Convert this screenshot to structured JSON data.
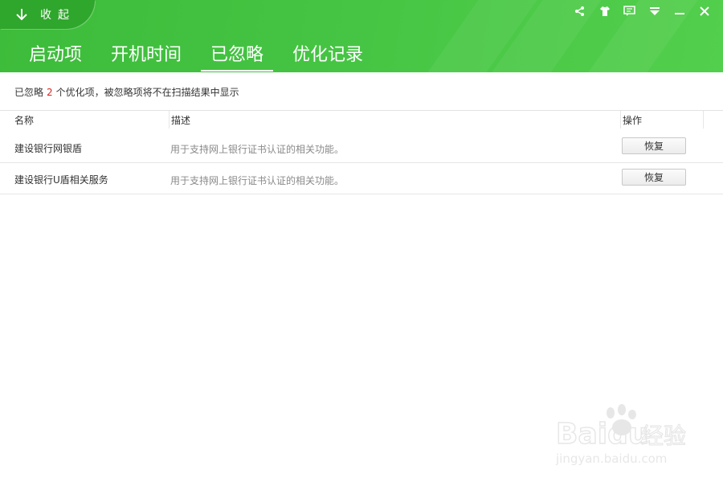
{
  "header": {
    "collapse_label": "收起",
    "window_controls": [
      "share-icon",
      "skin-icon",
      "feedback-icon",
      "menu-icon",
      "minimize-icon",
      "close-icon"
    ],
    "tabs": [
      {
        "label": "启动项",
        "active": false
      },
      {
        "label": "开机时间",
        "active": false
      },
      {
        "label": "已忽略",
        "active": true
      },
      {
        "label": "优化记录",
        "active": false
      }
    ],
    "accent": "#45c443"
  },
  "summary": {
    "prefix": "已忽略",
    "count": "2",
    "suffix": "个优化项，被忽略项将不在扫描结果中显示",
    "count_color": "#e02222"
  },
  "table": {
    "columns": [
      "名称",
      "描述",
      "操作"
    ],
    "rows": [
      {
        "name": "建设银行网银盾",
        "desc": "用于支持网上银行证书认证的相关功能。",
        "action": "恢复"
      },
      {
        "name": "建设银行U盾相关服务",
        "desc": "用于支持网上银行证书认证的相关功能。",
        "action": "恢复"
      }
    ]
  },
  "watermark": {
    "brand": "Baidu",
    "brand_cn": "经验",
    "url": "jingyan.baidu.com"
  }
}
